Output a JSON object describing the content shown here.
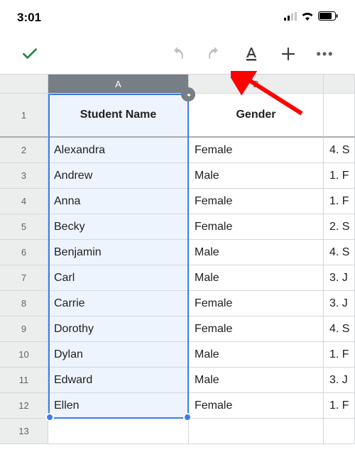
{
  "status": {
    "time": "3:01"
  },
  "columns": {
    "a": "A",
    "b": "B"
  },
  "header_row_num": "1",
  "headers": {
    "a": "Student Name",
    "b": "Gender"
  },
  "rows": [
    {
      "n": "2",
      "a": "Alexandra",
      "b": "Female",
      "c": "4. S"
    },
    {
      "n": "3",
      "a": "Andrew",
      "b": "Male",
      "c": "1. F"
    },
    {
      "n": "4",
      "a": "Anna",
      "b": "Female",
      "c": "1. F"
    },
    {
      "n": "5",
      "a": "Becky",
      "b": "Female",
      "c": "2. S"
    },
    {
      "n": "6",
      "a": "Benjamin",
      "b": "Male",
      "c": "4. S"
    },
    {
      "n": "7",
      "a": "Carl",
      "b": "Male",
      "c": "3. J"
    },
    {
      "n": "8",
      "a": "Carrie",
      "b": "Female",
      "c": "3. J"
    },
    {
      "n": "9",
      "a": "Dorothy",
      "b": "Female",
      "c": "4. S"
    },
    {
      "n": "10",
      "a": "Dylan",
      "b": "Male",
      "c": "1. F"
    },
    {
      "n": "11",
      "a": "Edward",
      "b": "Male",
      "c": "3. J"
    },
    {
      "n": "12",
      "a": "Ellen",
      "b": "Female",
      "c": "1. F"
    }
  ],
  "empty_row_num": "13"
}
